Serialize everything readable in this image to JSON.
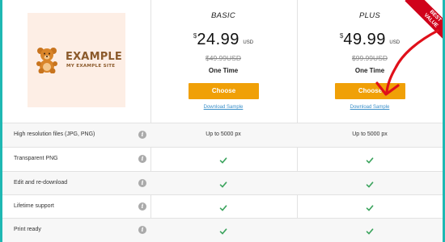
{
  "colors": {
    "accent": "#f0a007",
    "teal_edge": "#1fb8b3",
    "ribbon": "#d0021b",
    "check": "#3aa35c",
    "arrow": "#e0101a",
    "link": "#3a8fc9"
  },
  "logo": {
    "title": "EXAMPLE",
    "subtitle": "MY EXAMPLE SITE",
    "icon": "teddy-bear-icon"
  },
  "ribbon": {
    "line1": "BEST",
    "line2": "VALUE"
  },
  "plans": [
    {
      "name": "BASIC",
      "currency_symbol": "$",
      "price": "24.99",
      "currency_code": "USD",
      "old_price": "$49.99USD",
      "term": "One Time",
      "button": "Choose",
      "download": "Download Sample"
    },
    {
      "name": "PLUS",
      "currency_symbol": "$",
      "price": "49.99",
      "currency_code": "USD",
      "old_price": "$99.99USD",
      "term": "One Time",
      "button": "Choose",
      "download": "Download Sample"
    }
  ],
  "features": [
    {
      "label": "High resolution files (JPG, PNG)",
      "basic": "Up to 5000 px",
      "plus": "Up to 5000 px"
    },
    {
      "label": "Transparent PNG",
      "basic": "check",
      "plus": "check"
    },
    {
      "label": "Edit and re-download",
      "basic": "check",
      "plus": "check"
    },
    {
      "label": "Lifetime support",
      "basic": "check",
      "plus": "check"
    },
    {
      "label": "Print ready",
      "basic": "check",
      "plus": "check"
    }
  ],
  "info_icon": "i"
}
